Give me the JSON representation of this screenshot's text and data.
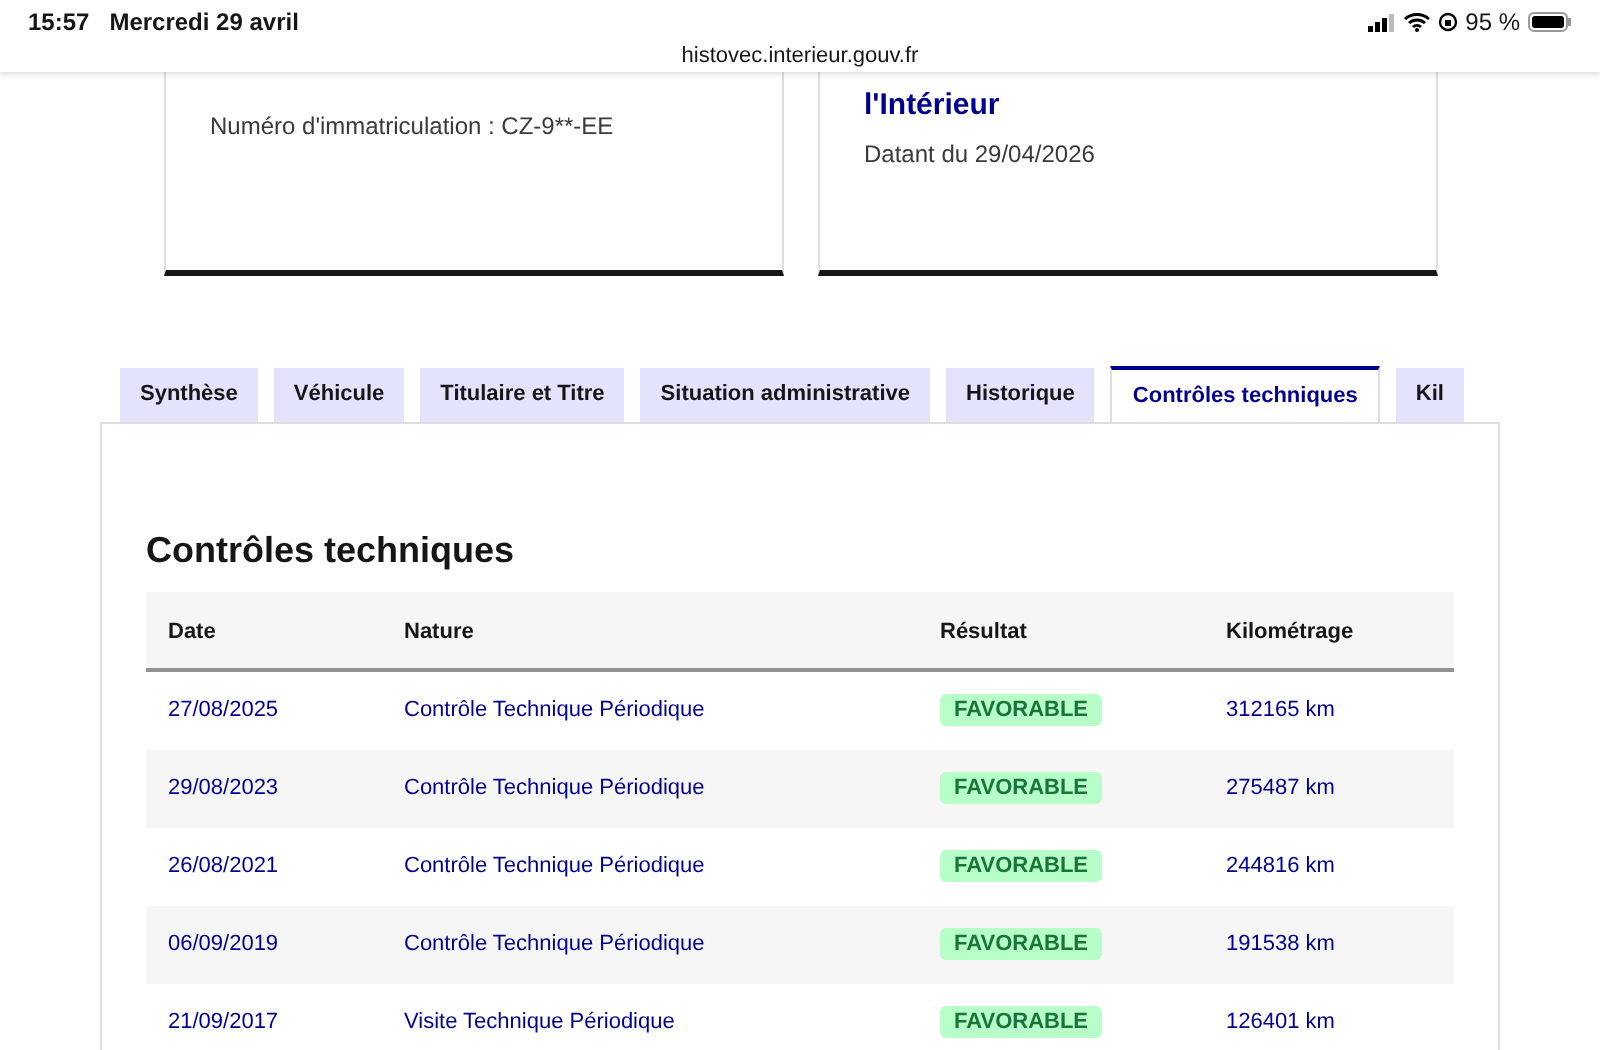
{
  "status_bar": {
    "time": "15:57",
    "date": "Mercredi 29 avril",
    "battery": "95 %"
  },
  "url": "histovec.interieur.gouv.fr",
  "cards": [
    {
      "text": "Numéro d'immatriculation : CZ-9**-EE"
    },
    {
      "title": "l'Intérieur",
      "text": "Datant du 29/04/2026"
    }
  ],
  "tabs": [
    {
      "label": "Synthèse",
      "selected": false
    },
    {
      "label": "Véhicule",
      "selected": false
    },
    {
      "label": "Titulaire et Titre",
      "selected": false
    },
    {
      "label": "Situation administrative",
      "selected": false
    },
    {
      "label": "Historique",
      "selected": false
    },
    {
      "label": "Contrôles techniques",
      "selected": true
    },
    {
      "label": "Kil",
      "selected": false
    }
  ],
  "section_title": "Contrôles techniques",
  "table": {
    "columns": [
      "Date",
      "Nature",
      "Résultat",
      "Kilométrage"
    ],
    "rows": [
      {
        "date": "27/08/2025",
        "nature": "Contrôle Technique Périodique",
        "result": "FAVORABLE",
        "km": "312165 km"
      },
      {
        "date": "29/08/2023",
        "nature": "Contrôle Technique Périodique",
        "result": "FAVORABLE",
        "km": "275487 km"
      },
      {
        "date": "26/08/2021",
        "nature": "Contrôle Technique Périodique",
        "result": "FAVORABLE",
        "km": "244816 km"
      },
      {
        "date": "06/09/2019",
        "nature": "Contrôle Technique Périodique",
        "result": "FAVORABLE",
        "km": "191538 km"
      },
      {
        "date": "21/09/2017",
        "nature": "Visite Technique Périodique",
        "result": "FAVORABLE",
        "km": "126401 km"
      }
    ]
  }
}
